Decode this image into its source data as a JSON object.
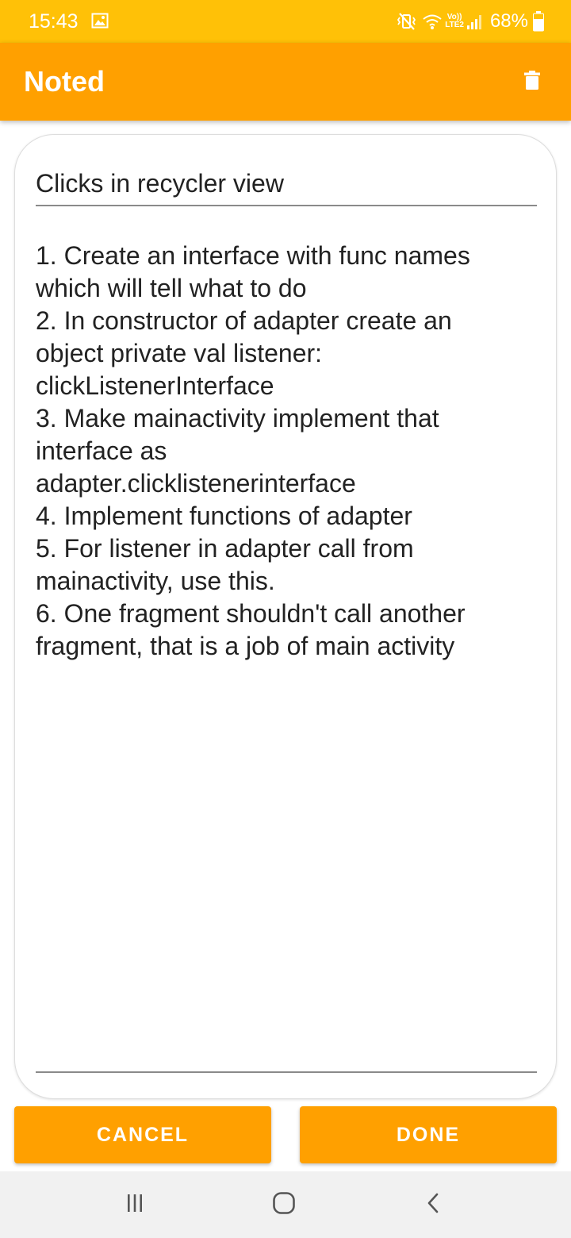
{
  "status_bar": {
    "time": "15:43",
    "network_top": "Vo))",
    "network_bottom": "LTE2",
    "battery": "68%",
    "icons": [
      "gallery-icon",
      "mute-vibrate-icon",
      "wifi-icon",
      "signal-icon",
      "battery-icon"
    ]
  },
  "app_bar": {
    "title": "Noted",
    "delete_icon": "trash-icon",
    "color": "#FFA000"
  },
  "note": {
    "title": "Clicks in recycler view",
    "body_lines": [
      "1. Create an interface with func names",
      "which will tell what to do",
      "2. In constructor of adapter create an",
      "object private val listener:",
      "clickListenerInterface",
      "3. Make mainactivity implement that",
      "interface as",
      "adapter.clicklistenerinterface",
      "4. Implement functions of adapter",
      "5. For listener in adapter call from",
      "mainactivity, use this.",
      "6. One fragment shouldn't call another",
      "fragment, that is a job of main activity"
    ]
  },
  "actions": {
    "cancel_label": "CANCEL",
    "done_label": "DONE"
  },
  "nav_bar": {
    "icons": [
      "recent-apps-icon",
      "home-icon",
      "back-icon"
    ]
  },
  "colors": {
    "status_bar": "#FFC107",
    "accent": "#FFA000",
    "nav_bar": "#f1f1f1"
  }
}
